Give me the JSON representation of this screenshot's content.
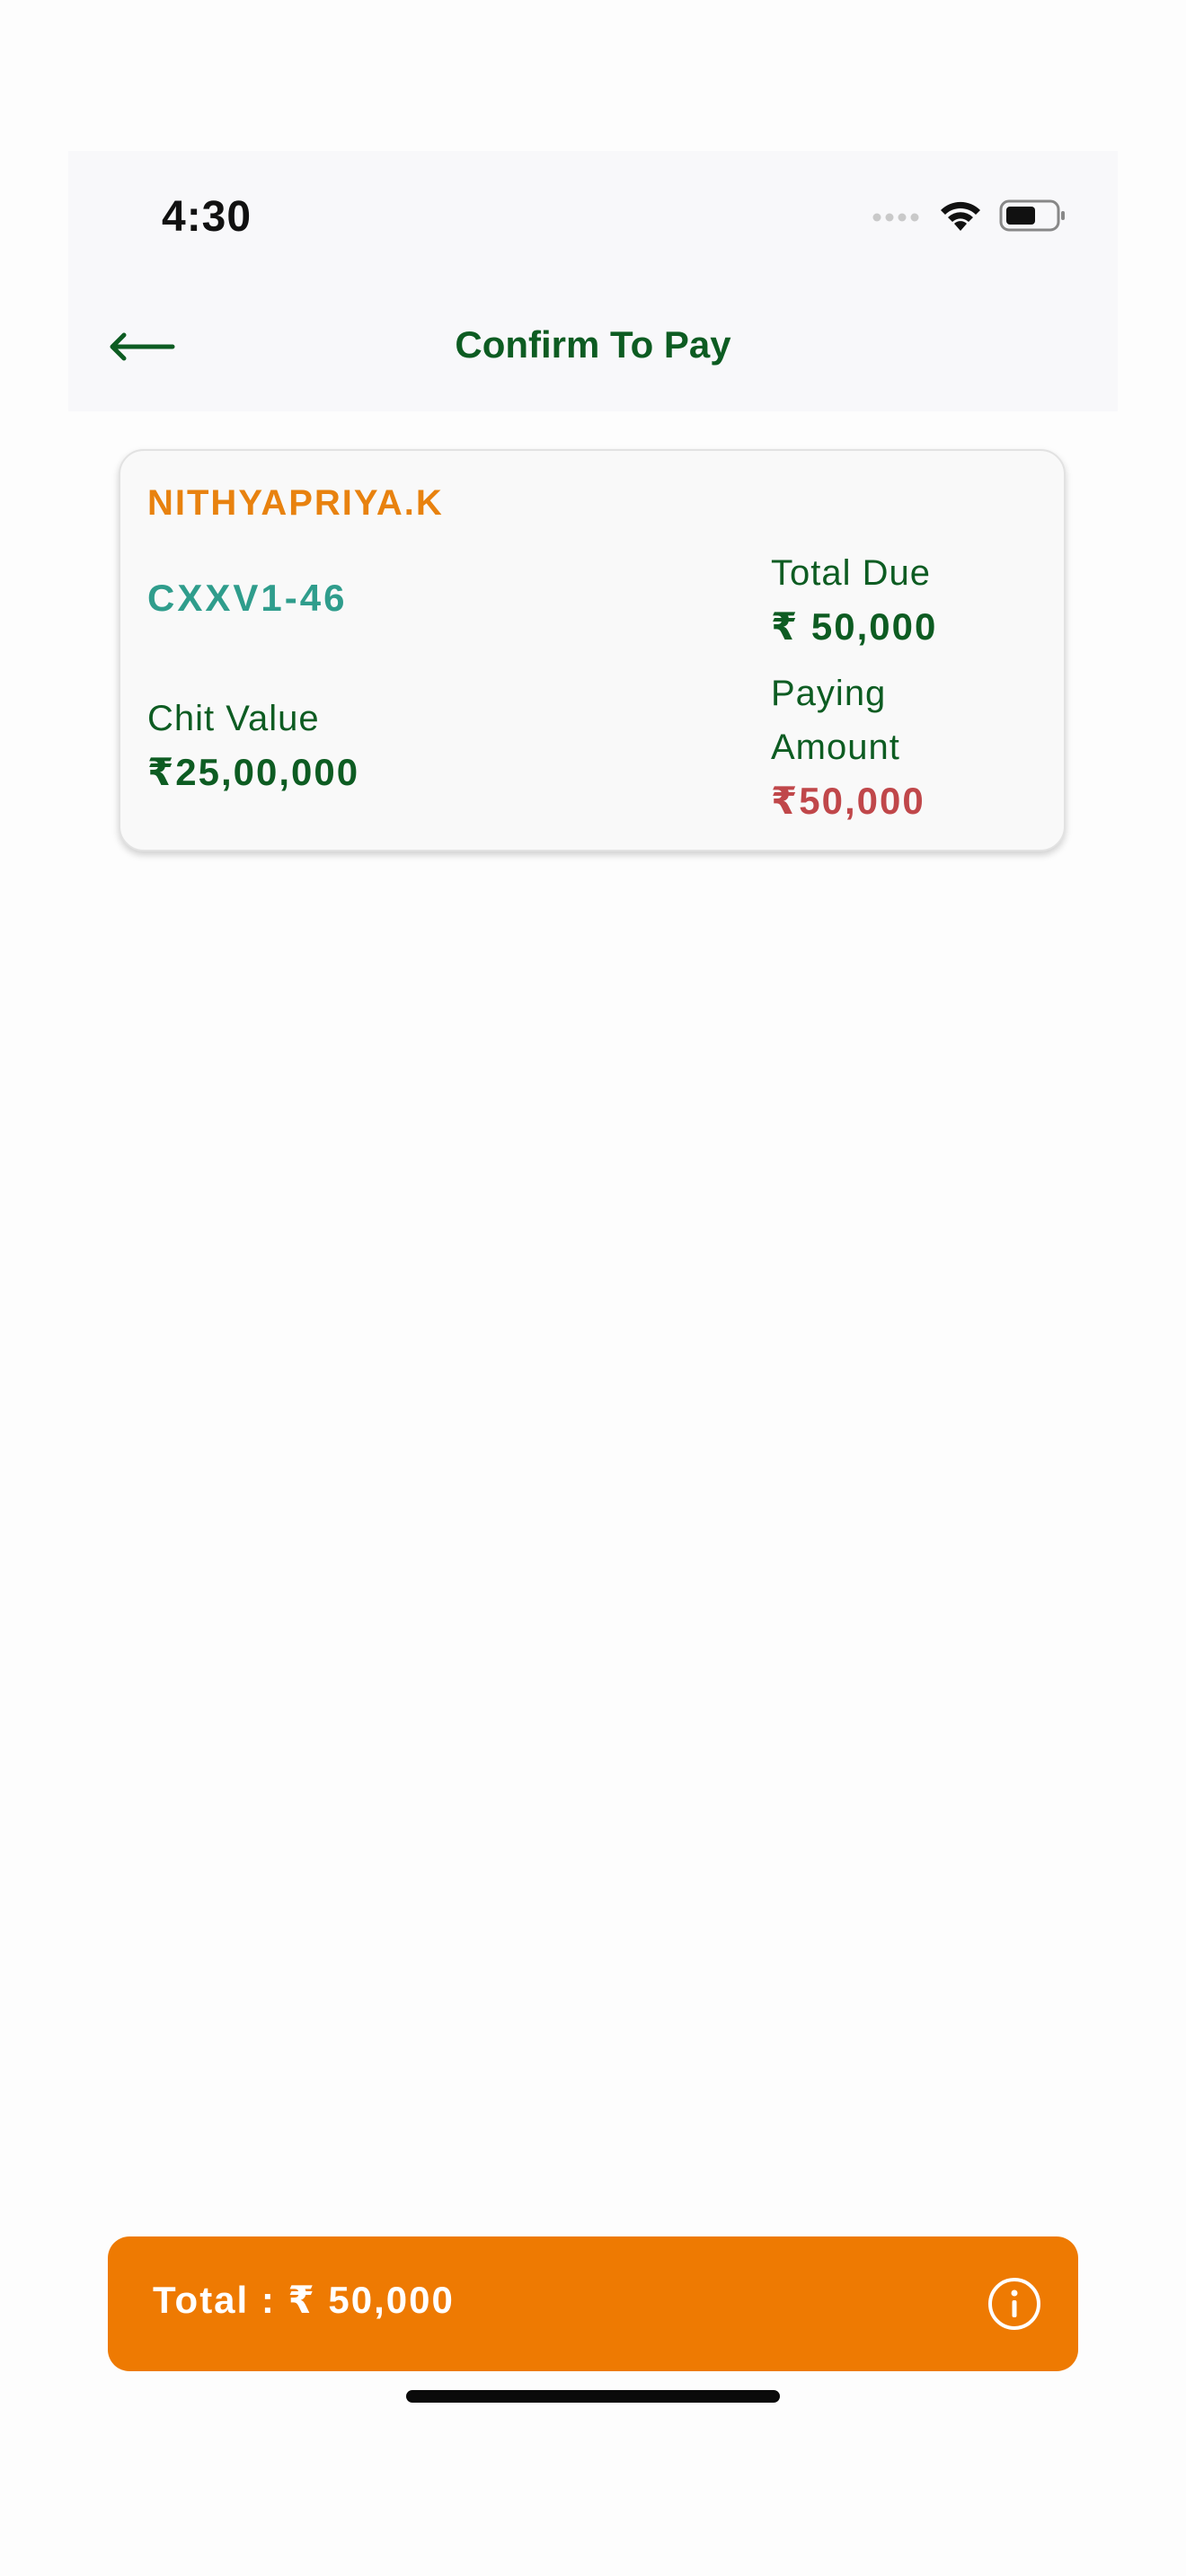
{
  "status_bar": {
    "time": "4:30"
  },
  "header": {
    "title": "Confirm To Pay",
    "back_icon": "arrow-left-icon"
  },
  "chit_card": {
    "member_name": "NITHYAPRIYA.K",
    "group_code": "CXXV1-46",
    "chit_value_label": "Chit Value",
    "chit_value": "₹25,00,000",
    "total_due_label": "Total Due",
    "total_due": "₹ 50,000",
    "paying_amount_label": "Paying Amount",
    "paying_amount": "₹50,000"
  },
  "footer": {
    "total_text": "Total : ₹ 50,000",
    "info_icon": "info-icon"
  },
  "colors": {
    "brand_green": "#0d5c22",
    "accent_orange": "#ee7a02",
    "name_orange": "#e8820f",
    "code_teal": "#2f9d8c",
    "amount_red": "#c0474a"
  }
}
